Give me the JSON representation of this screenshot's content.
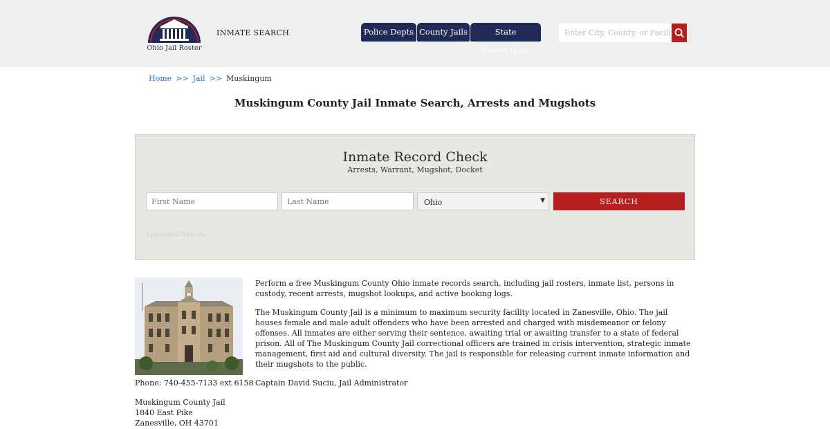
{
  "header": {
    "logo_text": "Ohio Jail Roster",
    "inmate_search_link": "INMATE SEARCH",
    "nav_tabs": [
      "Police Depts",
      "County Jails",
      "State Corrections"
    ],
    "search_placeholder": "Enter City, County, or Facility",
    "search_icon": "search-icon",
    "accent_color": "#b5201e",
    "nav_color": "#1f2a57"
  },
  "breadcrumb": {
    "home": "Home",
    "jail": "Jail",
    "separator": ">>",
    "current": "Muskingum"
  },
  "page_title": "Muskingum County Jail Inmate Search, Arrests and Mugshots",
  "record_check": {
    "title": "Inmate Record Check",
    "subtitle": "Arrests, Warrant, Mugshot, Docket",
    "first_name_placeholder": "First Name",
    "last_name_placeholder": "Last Name",
    "state_selected": "Ohio",
    "search_button": "SEARCH",
    "sponsored": "Sponsored Results"
  },
  "facility": {
    "phone": "Phone: 740-455-7133 ext 6158",
    "address_lines": [
      "Muskingum County Jail",
      "1840 East Pike",
      "Zanesville, OH 43701"
    ]
  },
  "content": {
    "paragraphs": [
      "Perform a free Muskingum County Ohio inmate records search, including jail rosters, inmate list, persons in custody, recent arrests, mugshot lookups, and active booking logs.",
      "The Muskingum County Jail is a minimum to maximum security facility located in Zanesville, Ohio. The jail houses female and male adult offenders who have been arrested and charged with misdemeanor or felony offenses. All inmates are either serving their sentence, awaiting trial or awaiting transfer to a state of federal prison. All of The Muskingum County Jail correctional officers are trained in crisis intervention, strategic inmate management, first aid and cultural diversity. The jail is responsible for releasing current inmate information and their mugshots to the public.",
      "Captain David Suciu, Jail Administrator"
    ]
  }
}
